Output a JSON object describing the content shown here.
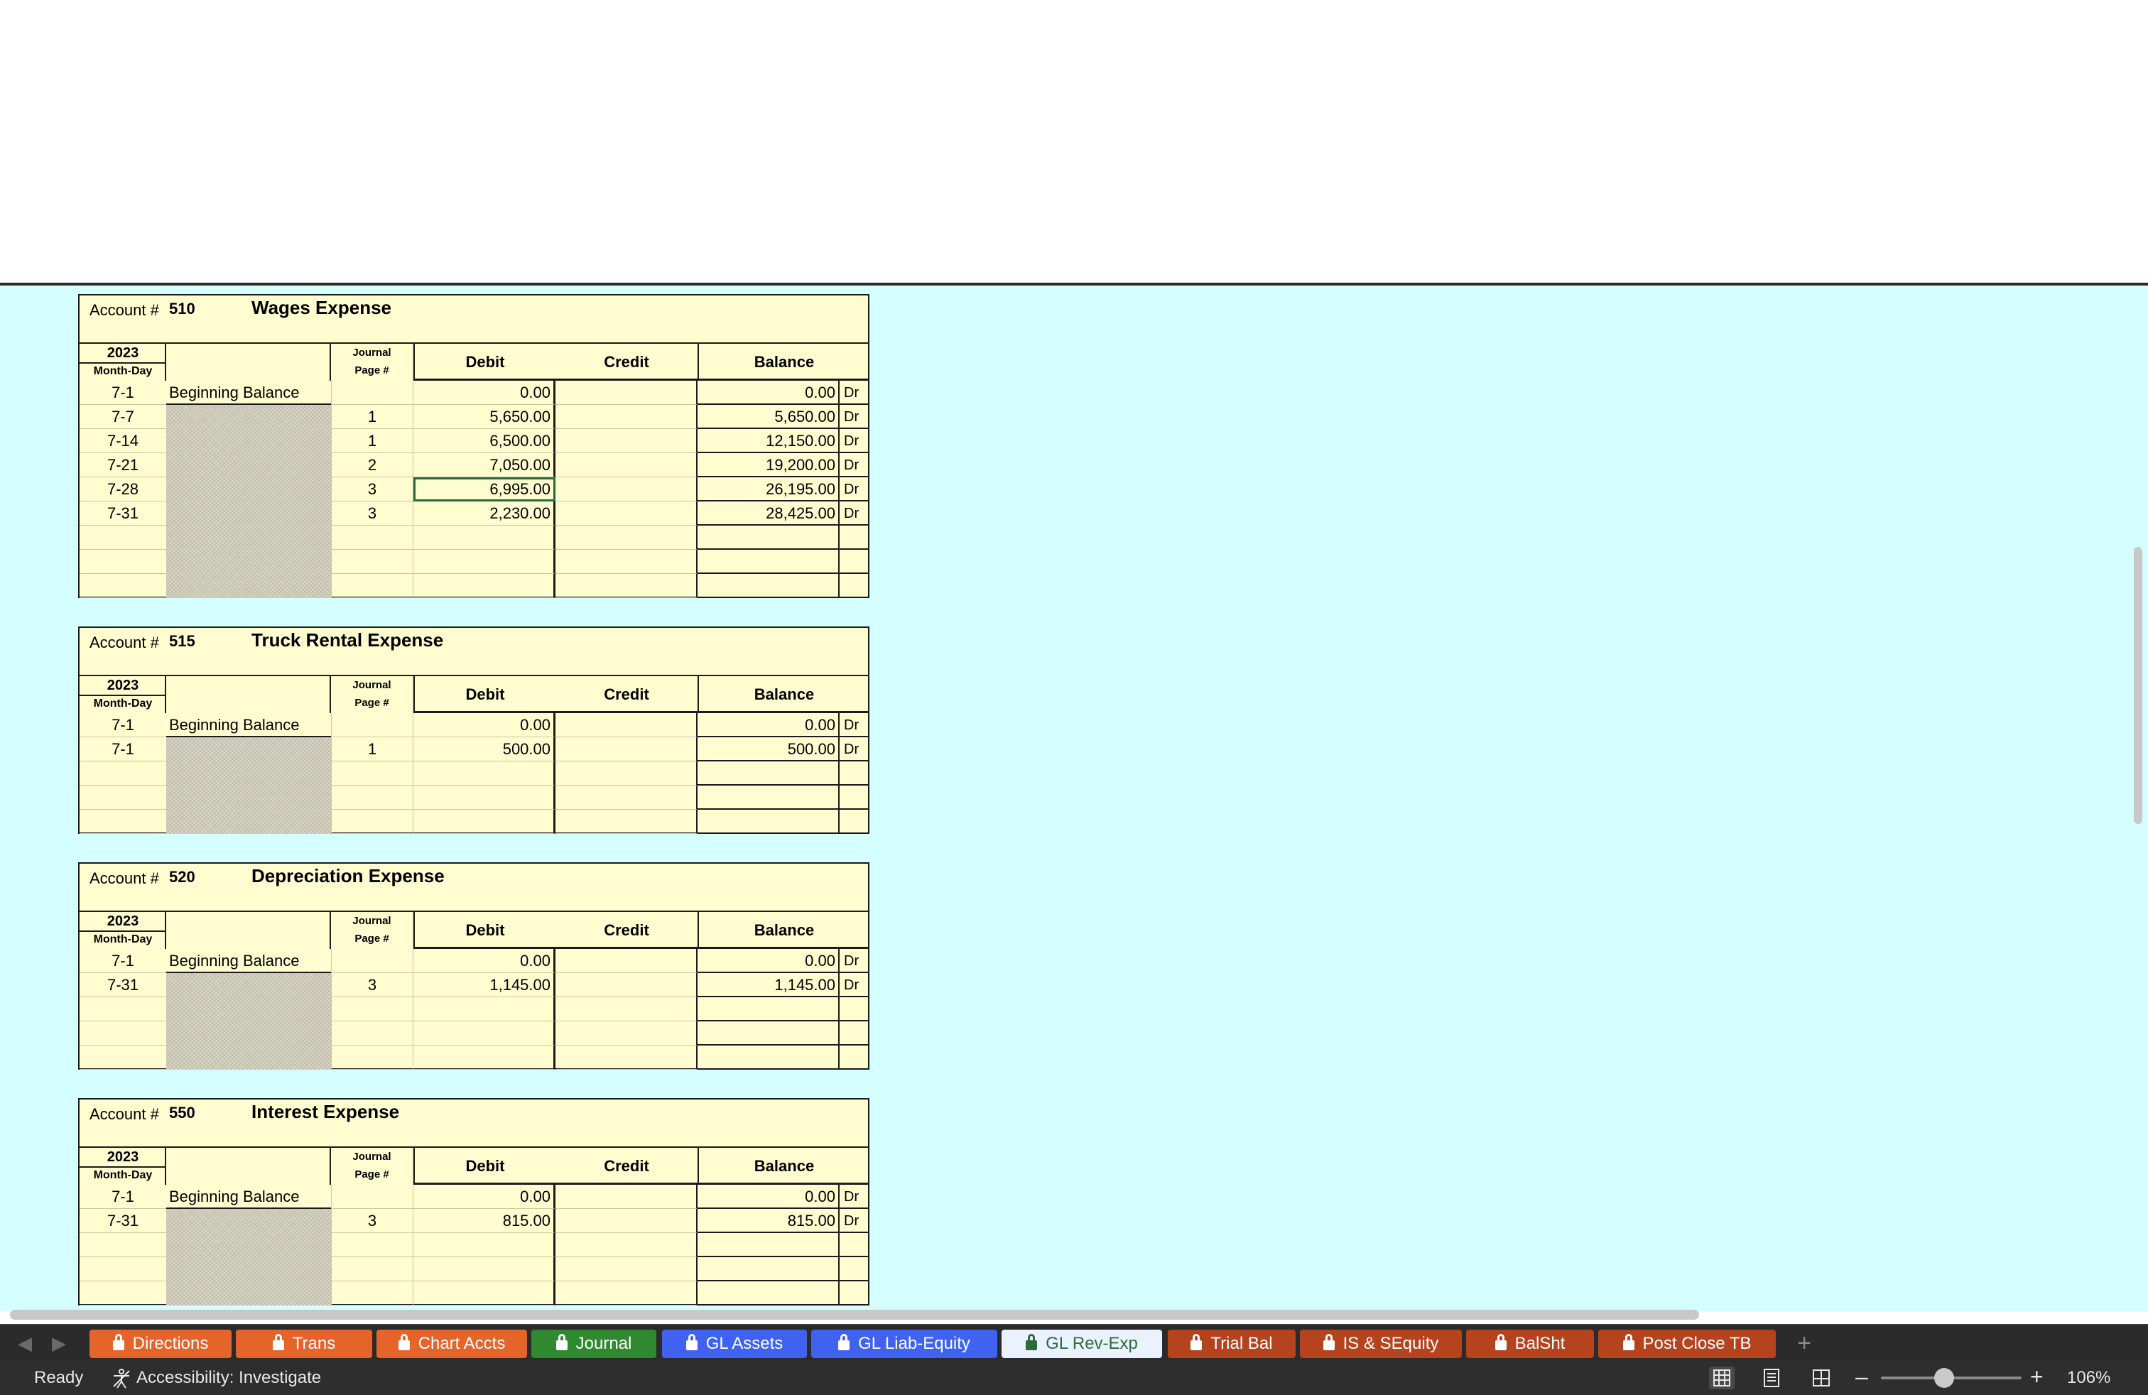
{
  "ledgers": [
    {
      "account_label": "Account #",
      "account_number": "510",
      "account_name": "Wages Expense",
      "year": "2023",
      "month_day_label": "Month-Day",
      "journal_label_1": "Journal",
      "journal_label_2": "Page #",
      "debit_label": "Debit",
      "credit_label": "Credit",
      "balance_label": "Balance",
      "rows": [
        {
          "date": "7-1",
          "desc": "Beginning Balance",
          "jp": "",
          "debit": "0.00",
          "balance": "0.00",
          "side": "Dr"
        },
        {
          "date": "7-7",
          "desc": "",
          "jp": "1",
          "debit": "5,650.00",
          "balance": "5,650.00",
          "side": "Dr"
        },
        {
          "date": "7-14",
          "desc": "",
          "jp": "1",
          "debit": "6,500.00",
          "balance": "12,150.00",
          "side": "Dr"
        },
        {
          "date": "7-21",
          "desc": "",
          "jp": "2",
          "debit": "7,050.00",
          "balance": "19,200.00",
          "side": "Dr"
        },
        {
          "date": "7-28",
          "desc": "",
          "jp": "3",
          "debit": "6,995.00",
          "balance": "26,195.00",
          "side": "Dr"
        },
        {
          "date": "7-31",
          "desc": "",
          "jp": "3",
          "debit": "2,230.00",
          "balance": "28,425.00",
          "side": "Dr"
        },
        {
          "date": "",
          "desc": "",
          "jp": "",
          "debit": "",
          "balance": "",
          "side": ""
        },
        {
          "date": "",
          "desc": "",
          "jp": "",
          "debit": "",
          "balance": "",
          "side": ""
        },
        {
          "date": "",
          "desc": "",
          "jp": "",
          "debit": "",
          "balance": "",
          "side": ""
        }
      ]
    },
    {
      "account_label": "Account #",
      "account_number": "515",
      "account_name": "Truck Rental Expense",
      "year": "2023",
      "month_day_label": "Month-Day",
      "journal_label_1": "Journal",
      "journal_label_2": "Page #",
      "debit_label": "Debit",
      "credit_label": "Credit",
      "balance_label": "Balance",
      "rows": [
        {
          "date": "7-1",
          "desc": "Beginning Balance",
          "jp": "",
          "debit": "0.00",
          "balance": "0.00",
          "side": "Dr"
        },
        {
          "date": "7-1",
          "desc": "",
          "jp": "1",
          "debit": "500.00",
          "balance": "500.00",
          "side": "Dr"
        },
        {
          "date": "",
          "desc": "",
          "jp": "",
          "debit": "",
          "balance": "",
          "side": ""
        },
        {
          "date": "",
          "desc": "",
          "jp": "",
          "debit": "",
          "balance": "",
          "side": ""
        },
        {
          "date": "",
          "desc": "",
          "jp": "",
          "debit": "",
          "balance": "",
          "side": ""
        }
      ]
    },
    {
      "account_label": "Account #",
      "account_number": "520",
      "account_name": "Depreciation Expense",
      "year": "2023",
      "month_day_label": "Month-Day",
      "journal_label_1": "Journal",
      "journal_label_2": "Page #",
      "debit_label": "Debit",
      "credit_label": "Credit",
      "balance_label": "Balance",
      "rows": [
        {
          "date": "7-1",
          "desc": "Beginning Balance",
          "jp": "",
          "debit": "0.00",
          "balance": "0.00",
          "side": "Dr"
        },
        {
          "date": "7-31",
          "desc": "",
          "jp": "3",
          "debit": "1,145.00",
          "balance": "1,145.00",
          "side": "Dr"
        },
        {
          "date": "",
          "desc": "",
          "jp": "",
          "debit": "",
          "balance": "",
          "side": ""
        },
        {
          "date": "",
          "desc": "",
          "jp": "",
          "debit": "",
          "balance": "",
          "side": ""
        },
        {
          "date": "",
          "desc": "",
          "jp": "",
          "debit": "",
          "balance": "",
          "side": ""
        }
      ]
    },
    {
      "account_label": "Account #",
      "account_number": "550",
      "account_name": "Interest Expense",
      "year": "2023",
      "month_day_label": "Month-Day",
      "journal_label_1": "Journal",
      "journal_label_2": "Page #",
      "debit_label": "Debit",
      "credit_label": "Credit",
      "balance_label": "Balance",
      "rows": [
        {
          "date": "7-1",
          "desc": "Beginning Balance",
          "jp": "",
          "debit": "0.00",
          "balance": "0.00",
          "side": "Dr"
        },
        {
          "date": "7-31",
          "desc": "",
          "jp": "3",
          "debit": "815.00",
          "balance": "815.00",
          "side": "Dr"
        },
        {
          "date": "",
          "desc": "",
          "jp": "",
          "debit": "",
          "balance": "",
          "side": ""
        },
        {
          "date": "",
          "desc": "",
          "jp": "",
          "debit": "",
          "balance": "",
          "side": ""
        },
        {
          "date": "",
          "desc": "",
          "jp": "",
          "debit": "",
          "balance": "",
          "side": ""
        }
      ]
    }
  ],
  "selected_cell": {
    "ledger": 0,
    "row": 4,
    "column": "debit"
  },
  "sheet_tabs": [
    {
      "label": "Directions",
      "color": "#e5642a",
      "locked": true,
      "active": false
    },
    {
      "label": "Trans",
      "color": "#e5642a",
      "locked": true,
      "active": false
    },
    {
      "label": "Chart Accts",
      "color": "#e5642a",
      "locked": true,
      "active": false
    },
    {
      "label": "Journal",
      "color": "#2f8a2f",
      "locked": true,
      "active": false
    },
    {
      "label": "GL Assets",
      "color": "#3f63f0",
      "locked": true,
      "active": false
    },
    {
      "label": "GL Liab-Equity",
      "color": "#3f63f0",
      "locked": true,
      "active": false
    },
    {
      "label": "GL Rev-Exp",
      "color": "#eaf1ff",
      "locked": true,
      "active": true
    },
    {
      "label": "Trial Bal",
      "color": "#b5431e",
      "locked": true,
      "active": false
    },
    {
      "label": "IS & SEquity",
      "color": "#b5431e",
      "locked": true,
      "active": false
    },
    {
      "label": "BalSht",
      "color": "#b5431e",
      "locked": true,
      "active": false
    },
    {
      "label": "Post Close TB",
      "color": "#b5431e",
      "locked": true,
      "active": false
    }
  ],
  "status": {
    "ready": "Ready",
    "accessibility": "Accessibility: Investigate",
    "zoom": "106%",
    "zoom_fraction": 0.45
  },
  "icons": {
    "prev_sheet": "chevron-left-icon",
    "next_sheet": "chevron-right-icon",
    "add_sheet": "plus-icon",
    "lock": "lock-icon",
    "accessibility": "accessibility-icon",
    "normal_view": "grid-view-icon",
    "page_layout": "page-layout-icon",
    "page_break": "page-break-icon"
  }
}
